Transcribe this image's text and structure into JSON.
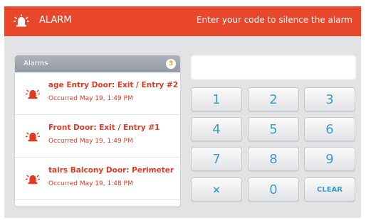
{
  "header": {
    "title": "ALARM",
    "message": "Enter your code to silence the alarm",
    "icon": "siren-icon",
    "background": "#e8472c"
  },
  "alarms_panel": {
    "title": "Alarms",
    "count": "3",
    "items": [
      {
        "name": "arage Entry Door: Exit / Entry #2",
        "time": "Occurred May 19, 1:49 PM"
      },
      {
        "name": "Front Door: Exit / Entry #1",
        "time": "Occurred May 19, 1:49 PM"
      },
      {
        "name": "tairs Balcony Door: Perimeter",
        "time": "Occurred May 19, 1:48 PM"
      }
    ]
  },
  "code_field": {
    "value": ""
  },
  "keypad": {
    "keys": [
      "1",
      "2",
      "3",
      "4",
      "5",
      "6",
      "7",
      "8",
      "9",
      "×",
      "0",
      "CLEAR"
    ],
    "key_color": "#3c9cd0"
  },
  "colors": {
    "alarm_text": "#e03a22",
    "badge": "#f0a21f"
  }
}
